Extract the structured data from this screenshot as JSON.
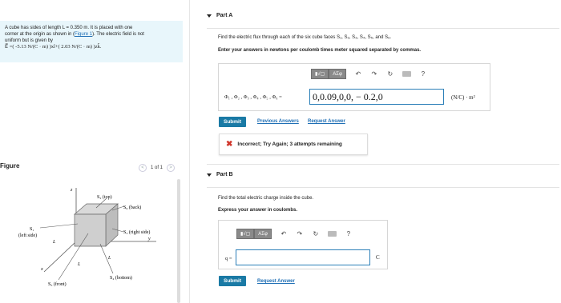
{
  "problem": {
    "line1": "A cube has sides of length L = 0.350 m. It is placed with one",
    "line2": "corner at the origin as shown in (",
    "figure_link": "Figure 1",
    "line2_end": "). The electric field is not",
    "line3": "uniform but is given by",
    "field_expr": "E⃗ =( -5.13 N/(C · m) )xî+( 2.03 N/(C · m) )zk̂."
  },
  "figure": {
    "title": "Figure",
    "nav_prev": "<",
    "nav_page": "1 of 1",
    "nav_next": ">",
    "labels": {
      "top": "S₂ (top)",
      "back": "S₆ (back)",
      "right": "S₃ (right side)",
      "left_s": "S₁",
      "left": "(left side)",
      "bottom": "S₄ (bottom)",
      "front": "S₅ (front)",
      "L": "L",
      "x": "x",
      "y": "y",
      "z": "z"
    }
  },
  "partA": {
    "header": "Part A",
    "question": "Find the electric flux through each of the six cube faces S₁, S₂, S₃, S₄, S₅, and S₆.",
    "instruction": "Enter your answers in newtons per coulomb times meter squared separated by commas.",
    "toolbar": {
      "templates": "▮√▢",
      "symbols": "ΑΣφ",
      "undo": "↶",
      "redo": "↷",
      "reset": "↻",
      "help": "?"
    },
    "input_label": "Φ₁ , Φ₂ , Φ₃ , Φ₄ , Φ₅ , Φ₆ =",
    "input_value": "0,0.09,0,0, − 0.2,0",
    "unit": "(N/C) · m²",
    "submit": "Submit",
    "previous_answers": "Previous Answers",
    "request_answer": "Request Answer",
    "feedback": "Incorrect; Try Again; 3 attempts remaining",
    "feedback_icon": "✖"
  },
  "partB": {
    "header": "Part B",
    "question": "Find the total electric charge inside the cube.",
    "instruction": "Express your answer in coulombs.",
    "toolbar": {
      "templates": "▮√▢",
      "symbols": "ΑΣφ",
      "undo": "↶",
      "redo": "↷",
      "reset": "↻",
      "help": "?"
    },
    "input_label": "q =",
    "input_value": "",
    "unit": "C",
    "submit": "Submit",
    "request_answer": "Request Answer"
  },
  "colors": {
    "accent": "#1a7aa5",
    "link": "#1f6fb5",
    "problem_bg": "#e8f6fb",
    "error": "#d0352a"
  }
}
